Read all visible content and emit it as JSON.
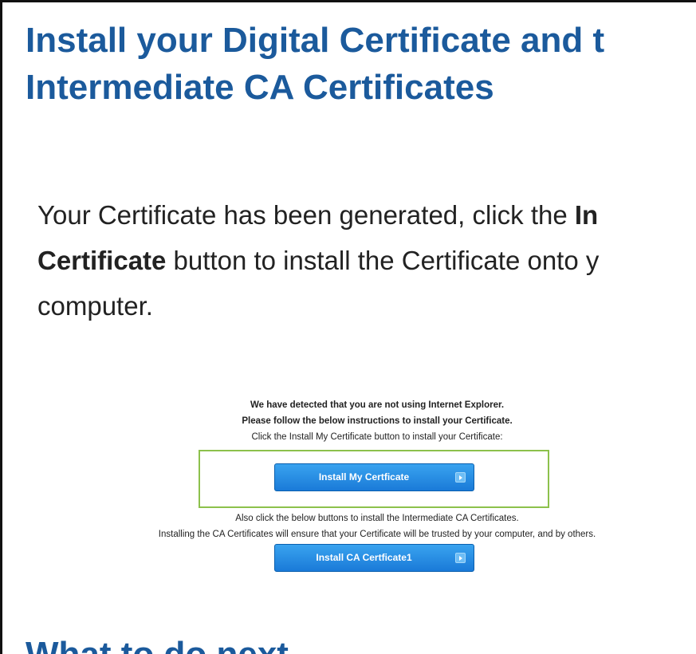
{
  "heading": {
    "line1": "Install your Digital Certificate and t",
    "line2": "Intermediate CA Certificates"
  },
  "intro": {
    "line1_prefix": "Your Certificate has been generated, click the ",
    "line1_bold": "In",
    "line2_bold": "Certificate",
    "line2_rest": " button to install the Certificate onto y",
    "line3": "computer."
  },
  "install_panel": {
    "detect_notice": "We have detected that you are not using Internet Explorer.",
    "follow_instructions": "Please follow the below instructions to install your Certificate.",
    "click_instruction": "Click the Install My Certificate button to install your Certificate:",
    "install_my_cert_label": "Install My Certficate",
    "also_click": "Also click the below buttons to install the Intermediate CA Certificates.",
    "trust_note": "Installing the CA Certificates will ensure that your Certificate will be trusted by your computer, and by others.",
    "install_ca_cert_label": "Install CA Certficate1"
  },
  "next_section": {
    "heading": "What to do next"
  },
  "colors": {
    "heading": "#1b5a9c",
    "button": "#1a7ad8",
    "highlight_border": "#8cc14c"
  },
  "icons": {
    "button_arrow": "play-arrow-icon"
  }
}
